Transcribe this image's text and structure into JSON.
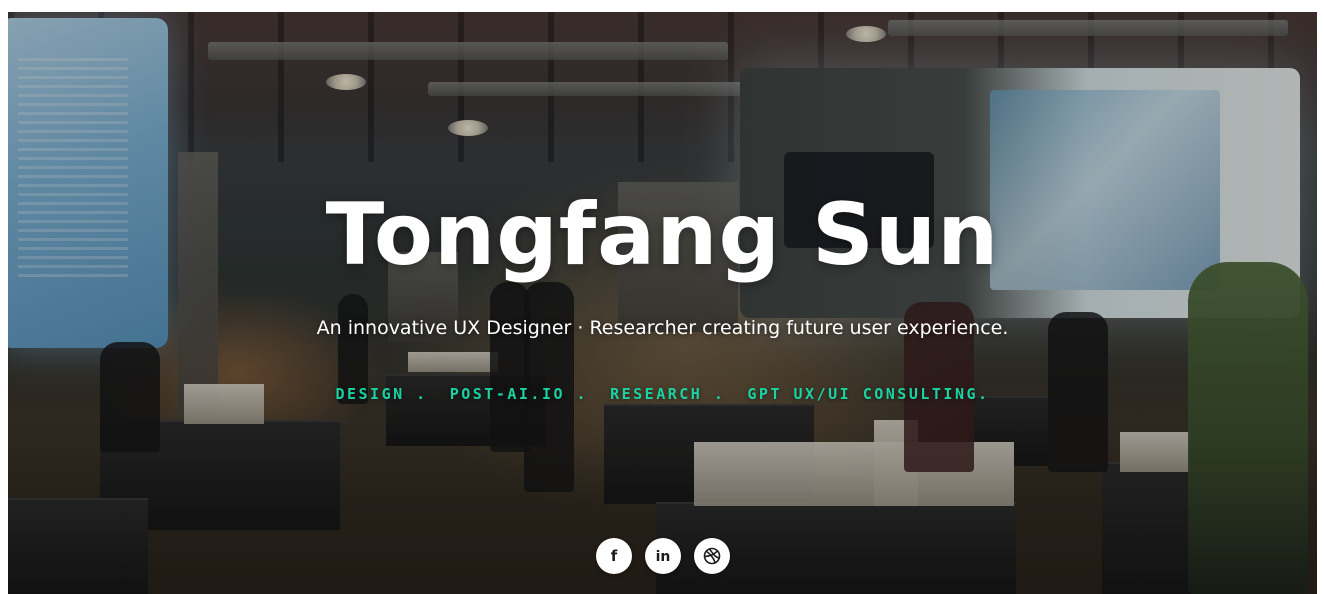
{
  "hero": {
    "title": "Tongfang Sun",
    "subtitle": "An innovative UX Designer · Researcher creating future user experience.",
    "tags": [
      {
        "label": "DESIGN ."
      },
      {
        "label": "POST-AI.IO ."
      },
      {
        "label": "RESEARCH ."
      },
      {
        "label": "GPT UX/UI CONSULTING."
      }
    ],
    "accent_color": "#19d3a2",
    "title_color": "#ffffff"
  },
  "social": [
    {
      "icon": "facebook-icon",
      "glyph": "f"
    },
    {
      "icon": "linkedin-icon",
      "glyph": "in"
    },
    {
      "icon": "dribbble-icon",
      "glyph": ""
    }
  ],
  "background": {
    "description_icon": "gallery-photo"
  }
}
